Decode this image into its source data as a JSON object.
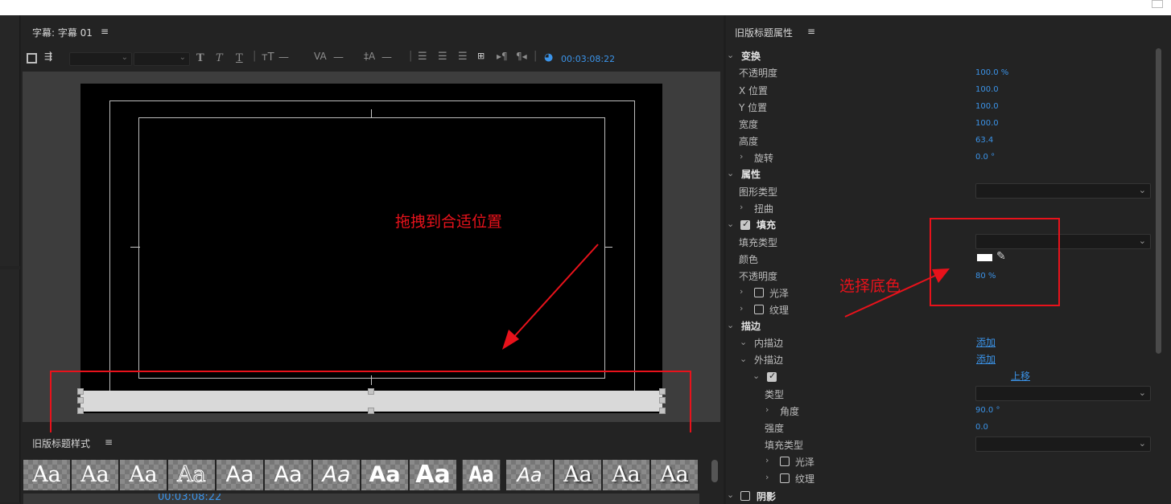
{
  "editor": {
    "title": "字幕: 字幕 01",
    "menu": "≡",
    "toolbar": {
      "bold": "T",
      "italic": "T",
      "underline": "T",
      "timecode": "00:03:08:22"
    },
    "annotation": "拖拽到合适位置"
  },
  "styles": {
    "title": "旧版标题样式",
    "menu": "≡",
    "swatches": [
      "Aa",
      "Aa",
      "Aa",
      "Aa",
      "Aa",
      "Aa",
      "Aa",
      "Aa",
      "Aa",
      "Aa",
      "Aa",
      "Aa",
      "Aa",
      "Aa"
    ],
    "partial_timecode": "00:03:08:22"
  },
  "props": {
    "title": "旧版标题属性",
    "menu": "≡",
    "transform": {
      "header": "变换",
      "opacity_label": "不透明度",
      "opacity_value": "100.0 %",
      "x_label": "X 位置",
      "x_value": "100.0",
      "y_label": "Y 位置",
      "y_value": "100.0",
      "width_label": "宽度",
      "width_value": "100.0",
      "height_label": "高度",
      "height_value": "63.4",
      "rotation_label": "旋转",
      "rotation_value": "0.0 °"
    },
    "attributes": {
      "header": "属性",
      "shape_label": "图形类型",
      "distort_label": "扭曲"
    },
    "fill": {
      "header": "填充",
      "type_label": "填充类型",
      "color_label": "颜色",
      "opacity_label": "不透明度",
      "opacity_value": "80 %",
      "sheen_label": "光泽",
      "texture_label": "纹理",
      "color_swatch": "#ffffff"
    },
    "stroke": {
      "header": "描边",
      "inner_label": "内描边",
      "inner_action": "添加",
      "outer_label": "外描边",
      "outer_action": "添加",
      "move_up": "上移",
      "type_label": "类型",
      "angle_label": "角度",
      "angle_value": "90.0 °",
      "strength_label": "强度",
      "strength_value": "0.0",
      "fill_type_label": "填充类型",
      "sheen_label": "光泽",
      "texture_label": "纹理"
    },
    "shadow": {
      "header": "阴影"
    },
    "annotation": "选择底色"
  },
  "colors": {
    "accent": "#3b93e8",
    "annotation": "#e8121b"
  }
}
